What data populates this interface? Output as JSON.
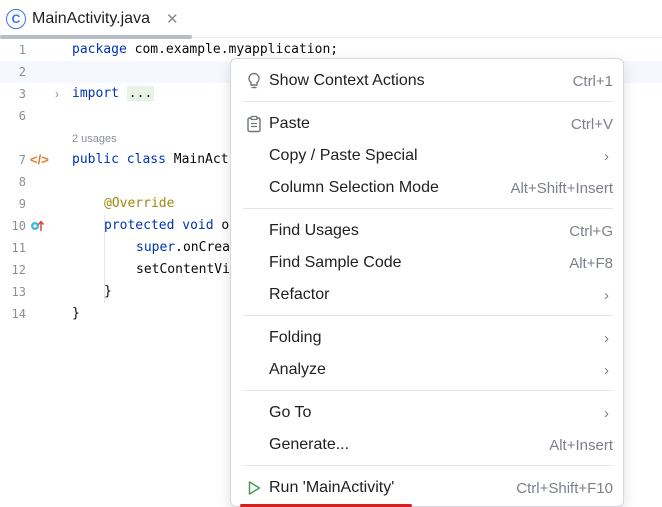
{
  "tab": {
    "icon": "C",
    "title": "MainActivity.java",
    "close": "✕"
  },
  "editor": {
    "lines": [
      {
        "num": "1",
        "code": "package com.example.myapplication;"
      },
      {
        "num": "2",
        "code": ""
      },
      {
        "num": "3",
        "code_kw": "import",
        "code_rest": " ..."
      },
      {
        "num": "6",
        "code": ""
      },
      {
        "usages": "2 usages"
      },
      {
        "num": "7",
        "code_kw": "public class",
        "code_rest": " MainAct"
      },
      {
        "num": "8",
        "code": ""
      },
      {
        "num": "9",
        "code_ann": "@Override"
      },
      {
        "num": "10",
        "code_kw": "protected void",
        "code_rest": " o"
      },
      {
        "num": "11",
        "code_kw": "super",
        "code_rest": ".onCrea"
      },
      {
        "num": "12",
        "code": "setContentVi"
      },
      {
        "num": "13",
        "code": "}"
      },
      {
        "num": "14",
        "code": "}"
      }
    ]
  },
  "context_menu": {
    "items": [
      {
        "label": "Show Context Actions",
        "shortcut": "Ctrl+1",
        "icon": "lightbulb-icon"
      },
      {
        "label": "Paste",
        "shortcut": "Ctrl+V",
        "icon": "clipboard-icon"
      },
      {
        "label": "Copy / Paste Special",
        "submenu": "›"
      },
      {
        "label": "Column Selection Mode",
        "shortcut": "Alt+Shift+Insert"
      },
      {
        "label": "Find Usages",
        "shortcut": "Ctrl+G"
      },
      {
        "label": "Find Sample Code",
        "shortcut": "Alt+F8"
      },
      {
        "label": "Refactor",
        "submenu": "›"
      },
      {
        "label": "Folding",
        "submenu": "›"
      },
      {
        "label": "Analyze",
        "submenu": "›"
      },
      {
        "label": "Go To",
        "submenu": "›"
      },
      {
        "label": "Generate...",
        "shortcut": "Alt+Insert"
      },
      {
        "label": "Run 'MainActivity'",
        "shortcut": "Ctrl+Shift+F10",
        "icon": "run-icon"
      }
    ]
  },
  "colors": {
    "accent": "#3574f0",
    "keyword": "#0033b3",
    "annotation": "#9e880d",
    "run_green": "#4e9a4e",
    "highlight_red": "#d61f1f"
  }
}
